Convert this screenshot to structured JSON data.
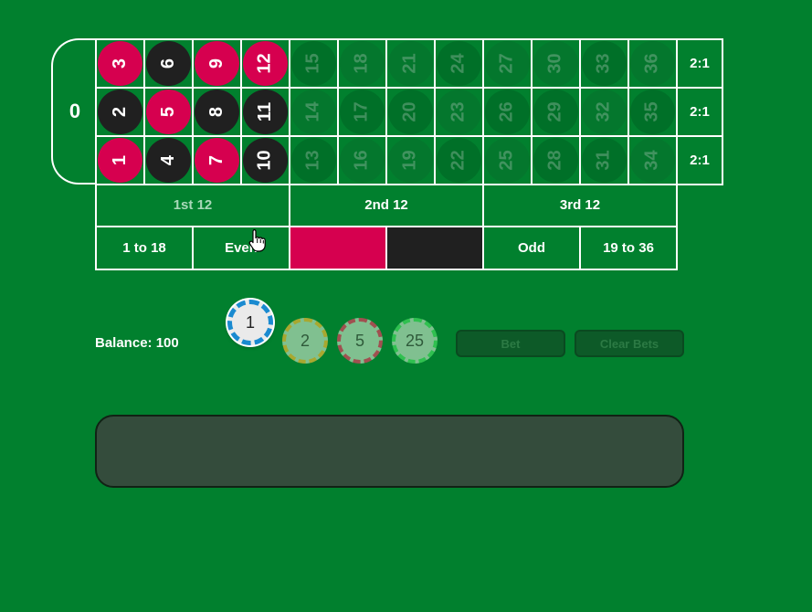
{
  "zero": "0",
  "numbers": [
    [
      "3",
      "6",
      "9",
      "12",
      "15",
      "18",
      "21",
      "24",
      "27",
      "30",
      "33",
      "36"
    ],
    [
      "2",
      "5",
      "8",
      "11",
      "14",
      "17",
      "20",
      "23",
      "26",
      "29",
      "32",
      "35"
    ],
    [
      "1",
      "4",
      "7",
      "10",
      "13",
      "16",
      "19",
      "22",
      "25",
      "28",
      "31",
      "34"
    ]
  ],
  "colors": {
    "red": [
      "1",
      "3",
      "5",
      "7",
      "9",
      "12",
      "14",
      "16",
      "18",
      "19",
      "21",
      "23",
      "25",
      "27",
      "30",
      "32",
      "34",
      "36"
    ]
  },
  "active_numbers": [
    "1",
    "2",
    "3",
    "4",
    "5",
    "6",
    "7",
    "8",
    "9",
    "10",
    "11",
    "12"
  ],
  "column_bets": [
    "2:1",
    "2:1",
    "2:1"
  ],
  "dozens": [
    "1st 12",
    "2nd 12",
    "3rd 12"
  ],
  "outside": {
    "low": "1 to 18",
    "even": "Even",
    "odd": "Odd",
    "high": "19 to 36"
  },
  "balance": "Balance: 100",
  "chips": [
    "1",
    "2",
    "5",
    "25"
  ],
  "buttons": {
    "bet": "Bet",
    "clear": "Clear Bets"
  },
  "message": ""
}
